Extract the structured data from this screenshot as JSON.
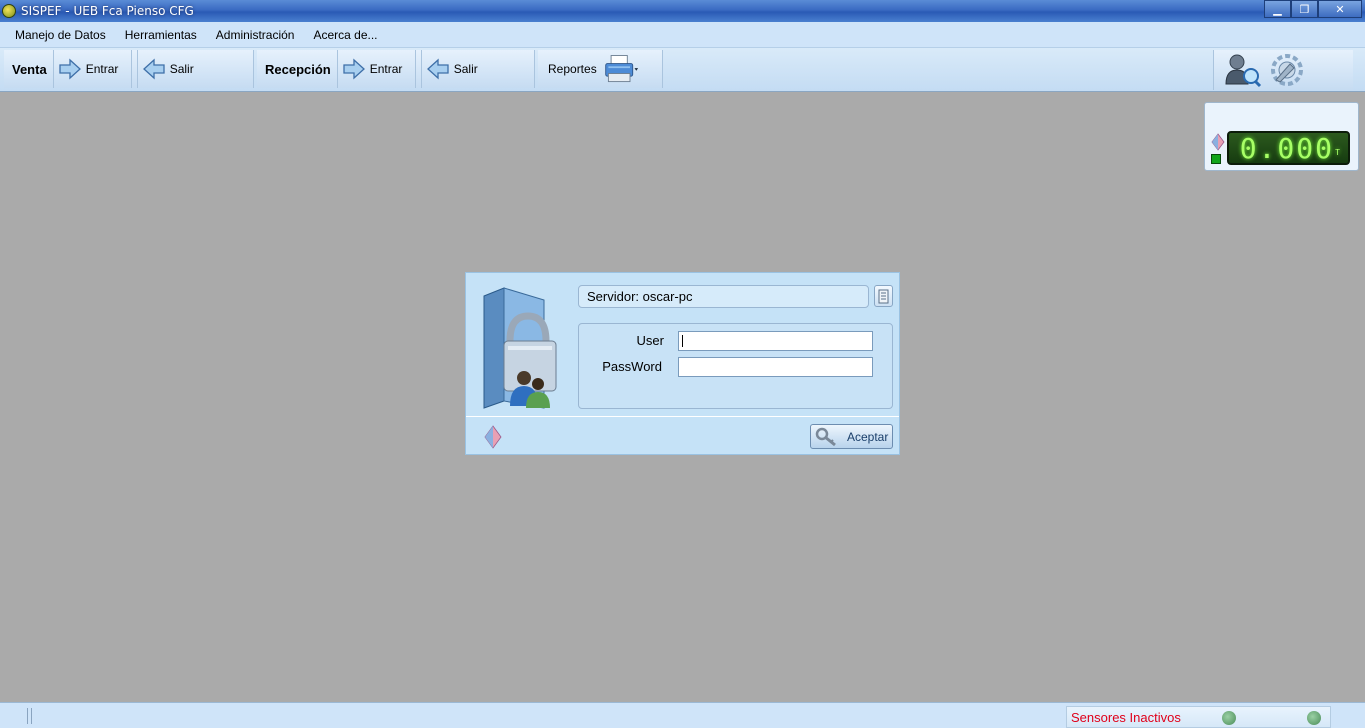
{
  "window": {
    "title": "SISPEF - UEB Fca Pienso CFG",
    "minimize": "▁",
    "restore": "❐",
    "close": "✕"
  },
  "menu": {
    "items": [
      "Manejo de Datos",
      "Herramientas",
      "Administración",
      "Acerca de..."
    ]
  },
  "toolbar": {
    "venta": {
      "label": "Venta",
      "enter": "Entrar",
      "exit": "Salir"
    },
    "recepcion": {
      "label": "Recepción",
      "enter": "Entrar",
      "exit": "Salir"
    },
    "reportes": {
      "label": "Reportes",
      "icon": "printer-icon"
    },
    "right_icons": [
      "user-search-icon",
      "settings-icon"
    ]
  },
  "scale_display": {
    "value": "0.000",
    "unit": "T",
    "status_color": "#11a51a"
  },
  "login": {
    "server_label": "Servidor: oscar-pc",
    "user_label": "User",
    "password_label": "PassWord",
    "user_value": "",
    "password_value": "",
    "accept_label": "Aceptar"
  },
  "status": {
    "sensors_text": "Sensores Inactivos",
    "sensors_color": "#e0001a"
  },
  "colors": {
    "desktop": "#aaaaaa",
    "toolbar": "#cfe4f9",
    "dialog": "#c5e2f7",
    "lcd_text": "#a8ff66"
  }
}
